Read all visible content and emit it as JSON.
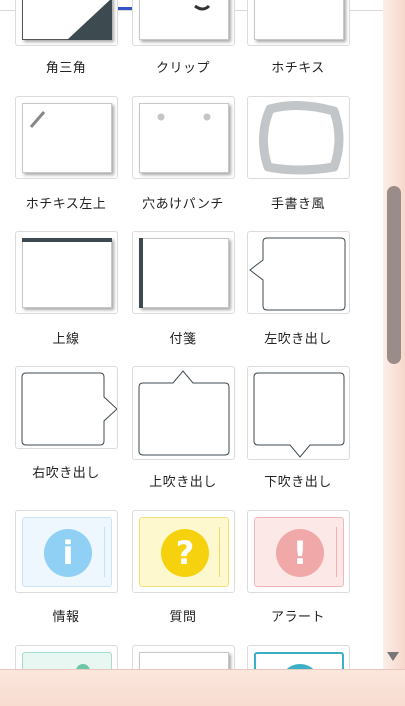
{
  "items": [
    {
      "label": "角三角"
    },
    {
      "label": "クリップ"
    },
    {
      "label": "ホチキス"
    },
    {
      "label": "ホチキス左上"
    },
    {
      "label": "穴あけパンチ"
    },
    {
      "label": "手書き風"
    },
    {
      "label": "上線"
    },
    {
      "label": "付箋"
    },
    {
      "label": "左吹き出し"
    },
    {
      "label": "右吹き出し"
    },
    {
      "label": "上吹き出し"
    },
    {
      "label": "下吹き出し"
    },
    {
      "label": "情報",
      "symbol": "i",
      "color": "#8fd0f4"
    },
    {
      "label": "質問",
      "symbol": "?",
      "color": "#f5d20d"
    },
    {
      "label": "アラート",
      "symbol": "!",
      "color": "#f0a8a8"
    }
  ]
}
